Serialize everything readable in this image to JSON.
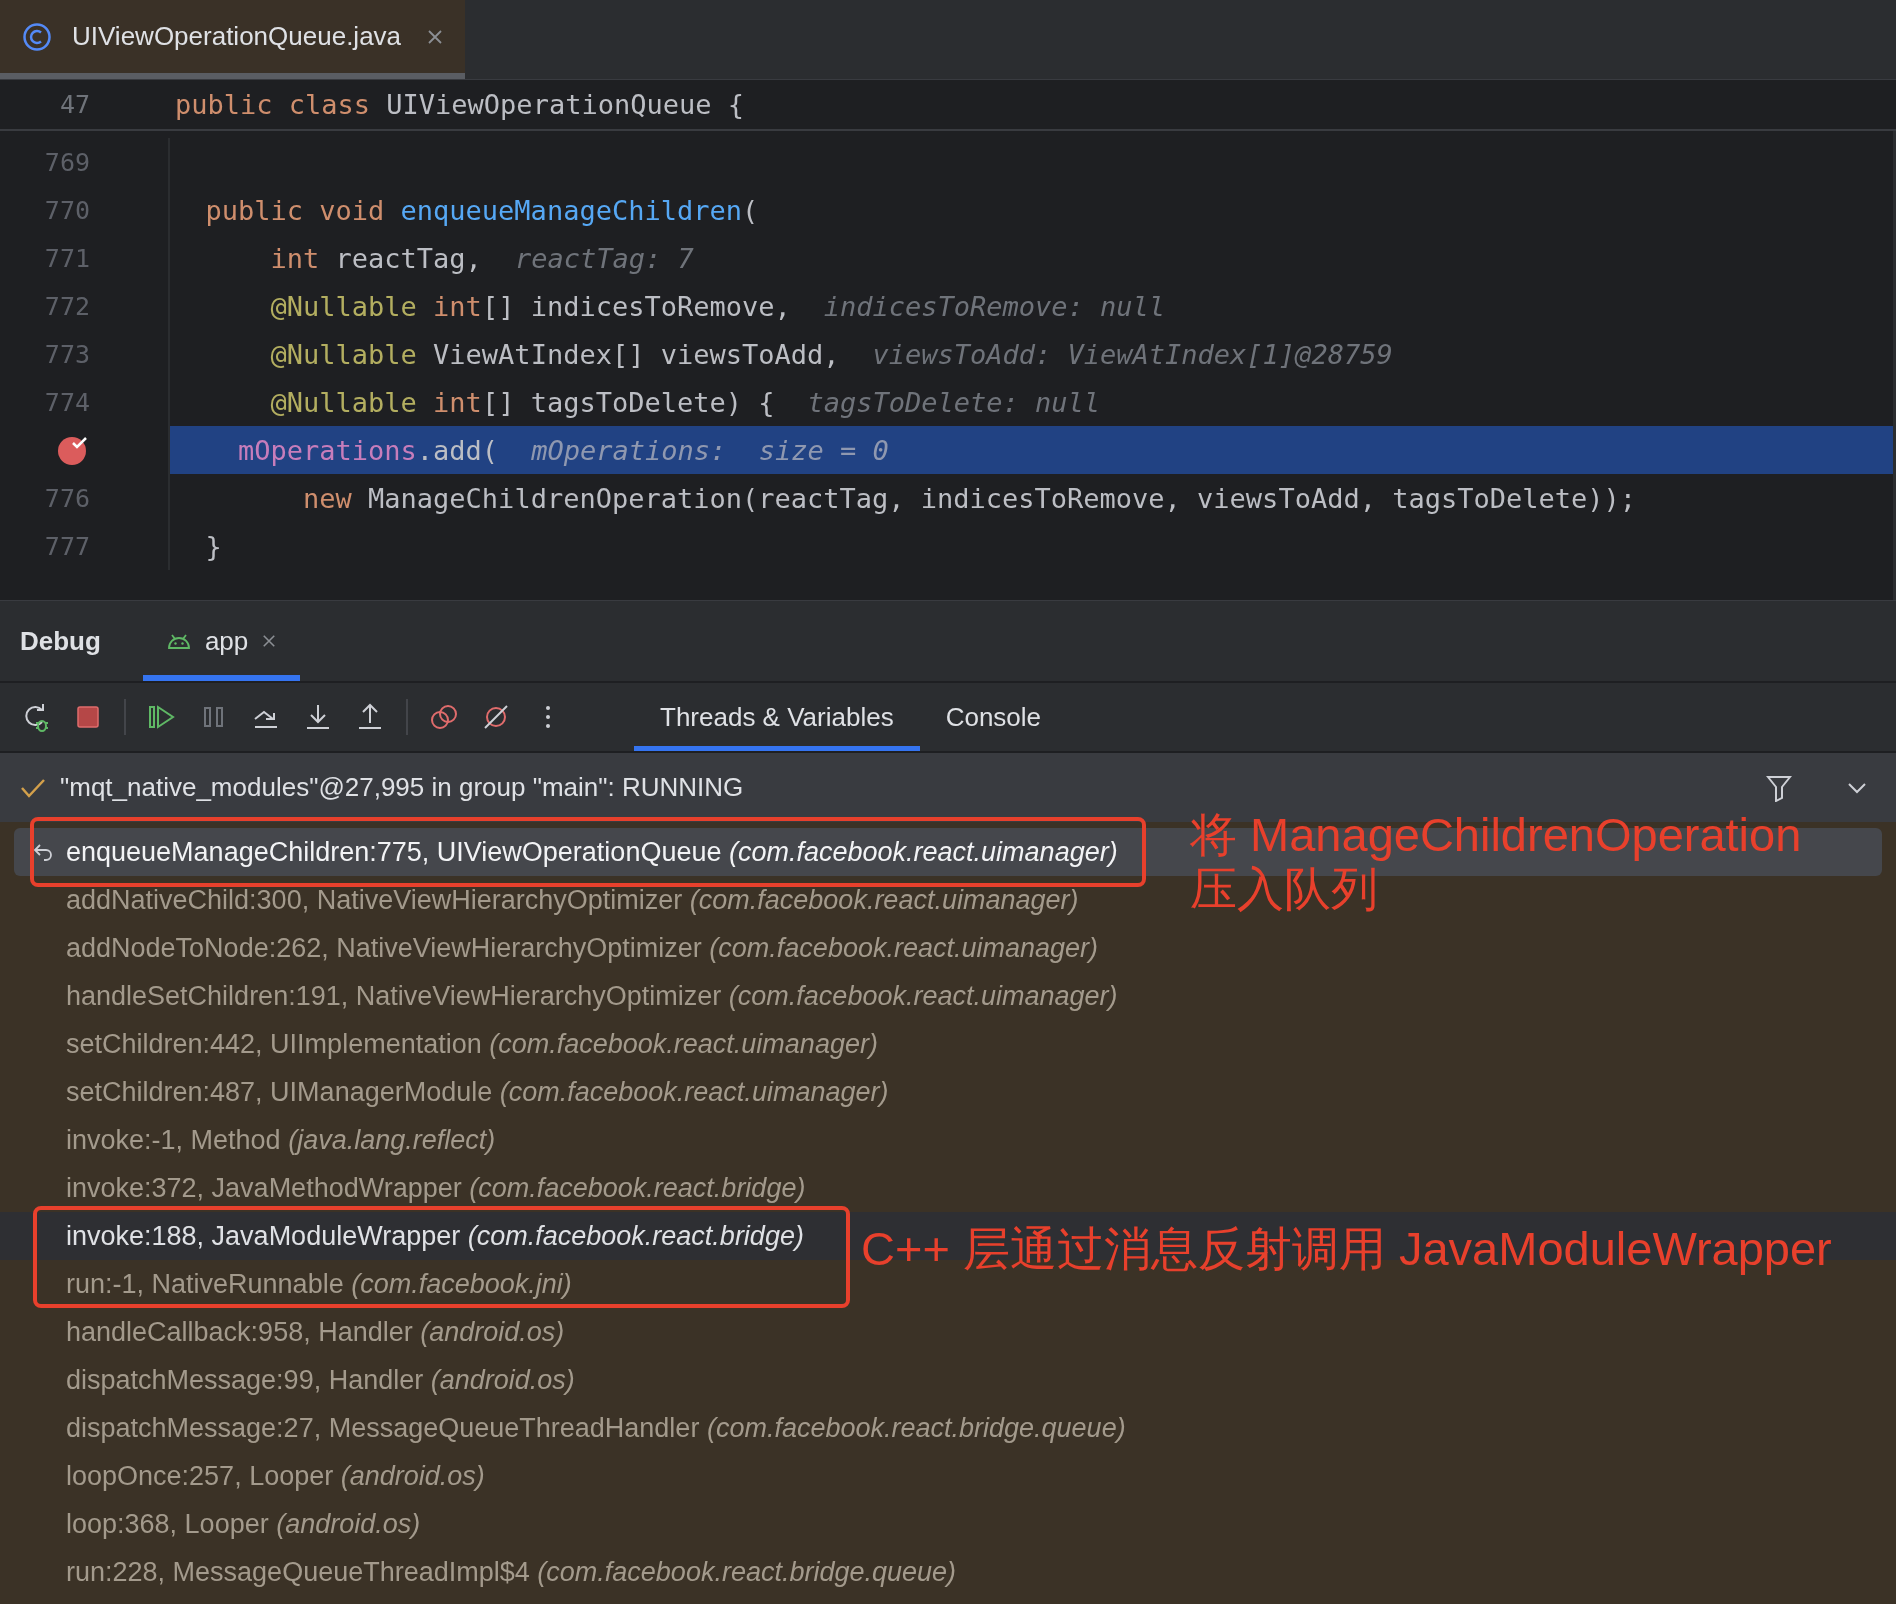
{
  "editor_tab": {
    "title": "UIViewOperationQueue.java",
    "selected": true
  },
  "sticky_line": {
    "number": "47",
    "tokens": [
      {
        "kind": "kw",
        "text": "public class "
      },
      {
        "kind": "plain",
        "text": "UIViewOperationQueue {"
      }
    ]
  },
  "code_lines": [
    {
      "number": "769",
      "breakpoint": false,
      "current": false
    },
    {
      "number": "770",
      "breakpoint": false,
      "current": false,
      "tokens": [
        {
          "kind": "kw",
          "text": "  public void "
        },
        {
          "kind": "fn",
          "text": "enqueueManageChildren"
        },
        {
          "kind": "plain",
          "text": "("
        }
      ]
    },
    {
      "number": "771",
      "breakpoint": false,
      "current": false,
      "tokens": [
        {
          "kind": "kw",
          "text": "      int "
        },
        {
          "kind": "plain",
          "text": "reactTag,"
        },
        {
          "kind": "hint",
          "text": "reactTag: 7"
        }
      ]
    },
    {
      "number": "772",
      "breakpoint": false,
      "current": false,
      "tokens": [
        {
          "kind": "ann",
          "text": "      @Nullable "
        },
        {
          "kind": "kw",
          "text": "int"
        },
        {
          "kind": "plain",
          "text": "[] indicesToRemove,"
        },
        {
          "kind": "hint",
          "text": "indicesToRemove: null"
        }
      ]
    },
    {
      "number": "773",
      "breakpoint": false,
      "current": false,
      "tokens": [
        {
          "kind": "ann",
          "text": "      @Nullable "
        },
        {
          "kind": "plain",
          "text": "ViewAtIndex[] viewsToAdd,"
        },
        {
          "kind": "hint",
          "text": "viewsToAdd: ViewAtIndex[1]@28759"
        }
      ]
    },
    {
      "number": "774",
      "breakpoint": false,
      "current": false,
      "tokens": [
        {
          "kind": "ann",
          "text": "      @Nullable "
        },
        {
          "kind": "kw",
          "text": "int"
        },
        {
          "kind": "plain",
          "text": "[] tagsToDelete) {"
        },
        {
          "kind": "hint",
          "text": "tagsToDelete: null"
        }
      ]
    },
    {
      "breakpoint": true,
      "current": true,
      "tokens": [
        {
          "kind": "field",
          "text": "    mOperations"
        },
        {
          "kind": "plain",
          "text": ".add("
        },
        {
          "kind": "hint",
          "text": "mOperations:  size = 0"
        }
      ]
    },
    {
      "number": "776",
      "breakpoint": false,
      "current": false,
      "tokens": [
        {
          "kind": "kw",
          "text": "        new "
        },
        {
          "kind": "plain",
          "text": "ManageChildrenOperation(reactTag, indicesToRemove, viewsToAdd, tagsToDelete));"
        }
      ]
    },
    {
      "number": "777",
      "breakpoint": false,
      "current": false,
      "tokens": [
        {
          "kind": "plain",
          "text": "  }"
        }
      ]
    }
  ],
  "debug": {
    "title": "Debug",
    "sessions": [
      {
        "label": "app",
        "selected": true
      }
    ]
  },
  "views": [
    {
      "label": "Threads & Variables",
      "selected": true
    },
    {
      "label": "Console",
      "selected": false
    }
  ],
  "thread": {
    "label": "\"mqt_native_modules\"@27,995 in group \"main\": RUNNING"
  },
  "frames": [
    {
      "method": "enqueueManageChildren:775, UIViewOperationQueue",
      "package": "(com.facebook.react.uimanager)",
      "selected": true,
      "hovered": false
    },
    {
      "method": "addNativeChild:300, NativeViewHierarchyOptimizer",
      "package": "(com.facebook.react.uimanager)",
      "selected": false,
      "hovered": false
    },
    {
      "method": "addNodeToNode:262, NativeViewHierarchyOptimizer",
      "package": "(com.facebook.react.uimanager)",
      "selected": false,
      "hovered": false
    },
    {
      "method": "handleSetChildren:191, NativeViewHierarchyOptimizer",
      "package": "(com.facebook.react.uimanager)",
      "selected": false,
      "hovered": false
    },
    {
      "method": "setChildren:442, UIImplementation",
      "package": "(com.facebook.react.uimanager)",
      "selected": false,
      "hovered": false
    },
    {
      "method": "setChildren:487, UIManagerModule",
      "package": "(com.facebook.react.uimanager)",
      "selected": false,
      "hovered": false
    },
    {
      "method": "invoke:-1, Method",
      "package": "(java.lang.reflect)",
      "selected": false,
      "hovered": false
    },
    {
      "method": "invoke:372, JavaMethodWrapper",
      "package": "(com.facebook.react.bridge)",
      "selected": false,
      "hovered": false
    },
    {
      "method": "invoke:188, JavaModuleWrapper",
      "package": "(com.facebook.react.bridge)",
      "selected": false,
      "hovered": true
    },
    {
      "method": "run:-1, NativeRunnable",
      "package": "(com.facebook.jni)",
      "selected": false,
      "hovered": false
    },
    {
      "method": "handleCallback:958, Handler",
      "package": "(android.os)",
      "selected": false,
      "hovered": false
    },
    {
      "method": "dispatchMessage:99, Handler",
      "package": "(android.os)",
      "selected": false,
      "hovered": false
    },
    {
      "method": "dispatchMessage:27, MessageQueueThreadHandler",
      "package": "(com.facebook.react.bridge.queue)",
      "selected": false,
      "hovered": false
    },
    {
      "method": "loopOnce:257, Looper",
      "package": "(android.os)",
      "selected": false,
      "hovered": false
    },
    {
      "method": "loop:368, Looper",
      "package": "(android.os)",
      "selected": false,
      "hovered": false
    },
    {
      "method": "run:228, MessageQueueThreadImpl$4",
      "package": "(com.facebook.react.bridge.queue)",
      "selected": false,
      "hovered": false
    }
  ],
  "annotations": [
    {
      "lines": [
        "将 ManageChildrenOperation",
        "压入队列"
      ]
    },
    {
      "lines": [
        "C++ 层通过消息反射调用 JavaModuleWrapper"
      ]
    }
  ]
}
